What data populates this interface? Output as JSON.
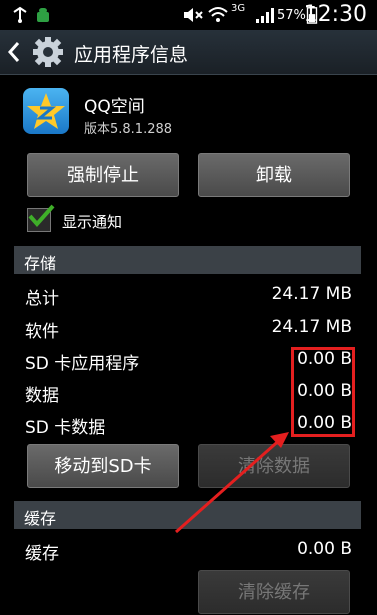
{
  "status_bar": {
    "battery_percent": "57%",
    "time": "12:30",
    "network_label": "3G"
  },
  "action_bar": {
    "title": "应用程序信息"
  },
  "app": {
    "name": "QQ空间",
    "version": "版本5.8.1.288"
  },
  "buttons": {
    "force_stop": "强制停止",
    "uninstall": "卸载",
    "move_to_sd": "移动到SD卡",
    "clear_data": "清除数据",
    "clear_cache": "清除缓存"
  },
  "notification": {
    "label": "显示通知",
    "checked": true
  },
  "storage": {
    "header": "存储",
    "rows": [
      {
        "label": "总计",
        "value": "24.17 MB"
      },
      {
        "label": "软件",
        "value": "24.17 MB"
      },
      {
        "label": "SD 卡应用程序",
        "value": "0.00 B"
      },
      {
        "label": "数据",
        "value": "0.00 B"
      },
      {
        "label": "SD 卡数据",
        "value": "0.00 B"
      }
    ]
  },
  "cache": {
    "header": "缓存",
    "rows": [
      {
        "label": "缓存",
        "value": "0.00 B"
      }
    ]
  },
  "colors": {
    "annotation": "#e41f1f",
    "check": "#3fae29",
    "section_bg": "#3b4147"
  }
}
